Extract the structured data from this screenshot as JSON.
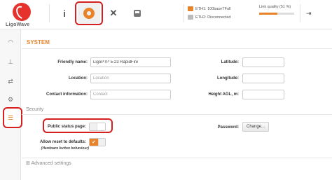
{
  "brand": {
    "name": "LigoWave"
  },
  "nav": {
    "info_icon": "info-icon",
    "settings_icon": "gear-icon",
    "tools_icon": "tools-icon",
    "device_icon": "device-icon"
  },
  "status": {
    "eth1_label": "ETH1:",
    "eth1_value": "100baseTFull",
    "eth2_label": "ETH2:",
    "eth2_value": "Disconnected",
    "link_quality_label": "Link quality (51 %)",
    "link_quality_percent": 51
  },
  "sidebar": {
    "items": [
      {
        "icon": "wifi-icon"
      },
      {
        "icon": "network-icon"
      },
      {
        "icon": "arrows-icon"
      },
      {
        "icon": "gears-icon"
      },
      {
        "icon": "system-list-icon"
      }
    ]
  },
  "system": {
    "title": "SYSTEM",
    "friendly_name_label": "Friendly name:",
    "friendly_name_value": "LigoPTP 5-23 RapidFire",
    "location_label": "Location:",
    "location_placeholder": "Location",
    "contact_label": "Contact information:",
    "contact_placeholder": "Contact",
    "latitude_label": "Latitude:",
    "longitude_label": "Longitude:",
    "height_label": "Height AGL, m:"
  },
  "security": {
    "title": "Security",
    "public_status_label": "Public status page:",
    "public_status_enabled": false,
    "allow_reset_label": "Allow reset to defaults:",
    "allow_reset_hint": "(Hardware button behaviour)",
    "allow_reset_enabled": true,
    "password_label": "Password:",
    "password_button": "Change..."
  },
  "advanced": {
    "label": "Advanced settings"
  },
  "colors": {
    "accent": "#e9832a",
    "highlight": "#d62020"
  }
}
